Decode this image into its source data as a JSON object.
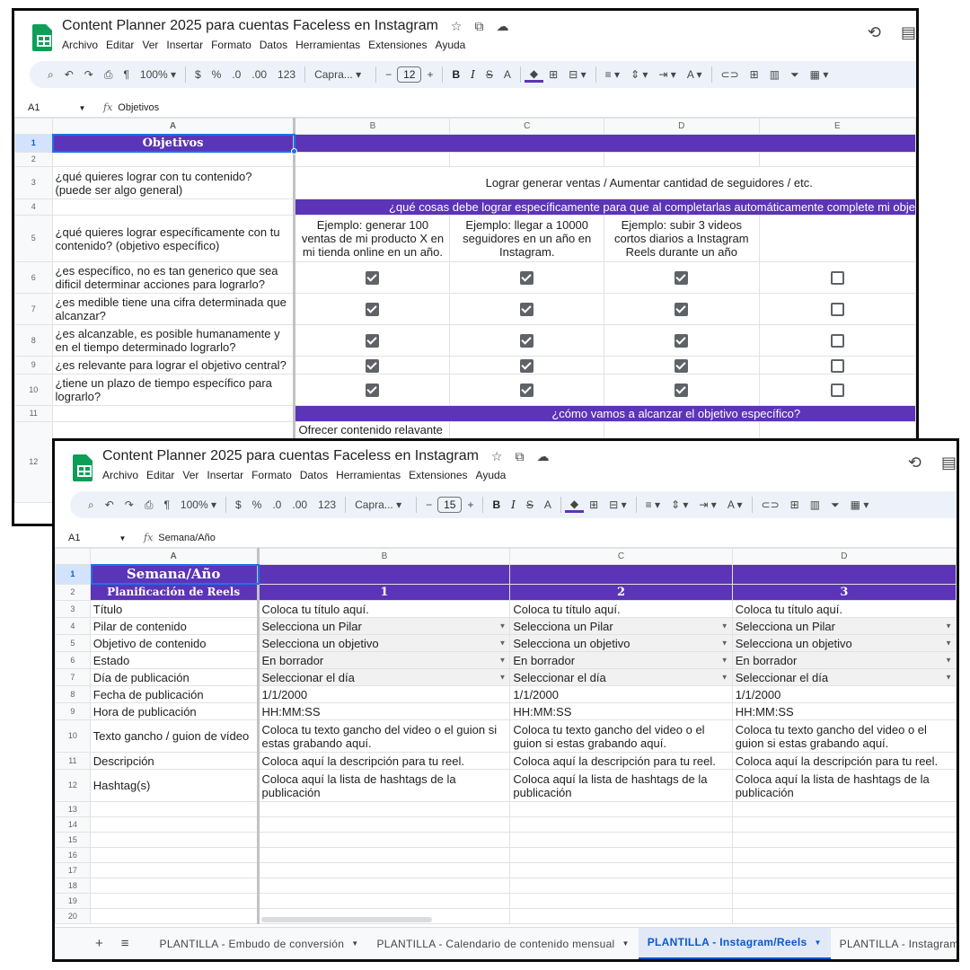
{
  "back_window": {
    "doc_title": "Content Planner 2025 para cuentas Faceless en Instagram",
    "menus": [
      "Archivo",
      "Editar",
      "Ver",
      "Insertar",
      "Formato",
      "Datos",
      "Herramientas",
      "Extensiones",
      "Ayuda"
    ],
    "toolbar": {
      "zoom": "100%",
      "currency": "$",
      "percent": "%",
      "dec_less": ".0",
      "dec_more": ".00",
      "number_format": "123",
      "font": "Capra...",
      "font_size": "12",
      "bold": "B",
      "italic": "I",
      "strike": "S",
      "text_color": "A"
    },
    "name_box": "A1",
    "formula": "Objetivos",
    "columns": [
      "A",
      "B",
      "C",
      "D",
      "E"
    ],
    "rows": [
      "1",
      "2",
      "3",
      "4",
      "5",
      "6",
      "7",
      "8",
      "9",
      "10",
      "11",
      "12"
    ],
    "title": "Objetivos",
    "goal_question": "¿qué quieres lograr con tu contenido? (puede ser algo general)",
    "goal_answer": "Lograr generar ventas / Aumentar cantidad de seguidores / etc.",
    "banner_row4": "¿qué cosas debe lograr específicamente para que al completarlas automáticamente complete mi obje",
    "specific_question": "¿qué quieres lograr específicamente con tu contenido? (objetivo específico)",
    "examples": [
      "Ejemplo: generar 100 ventas de mi producto X en mi tienda online en un año.",
      "Ejemplo: llegar a 10000 seguidores en un año en Instagram.",
      "Ejemplo: subir 3 videos cortos diarios a Instagram Reels durante un año"
    ],
    "criteria": [
      "¿es específico, no es tan generico que sea dificil determinar acciones para lograrlo?",
      "¿es medible tiene una cifra determinada que alcanzar?",
      "¿es alcanzable, es posible humanamente y en el tiempo determinado lograrlo?",
      "¿es relevante para lograr el objetivo central?",
      "¿tiene un plazo de tiempo específico para lograrlo?"
    ],
    "banner_row11": "¿cómo vamos a alcanzar el objetivo específico?",
    "row12_b": "Ofrecer contenido relavante"
  },
  "front_window": {
    "doc_title": "Content Planner 2025 para cuentas Faceless en Instagram",
    "menus": [
      "Archivo",
      "Editar",
      "Ver",
      "Insertar",
      "Formato",
      "Datos",
      "Herramientas",
      "Extensiones",
      "Ayuda"
    ],
    "toolbar": {
      "zoom": "100%",
      "currency": "$",
      "percent": "%",
      "dec_less": ".0",
      "dec_more": ".00",
      "number_format": "123",
      "font": "Capra...",
      "font_size": "15",
      "bold": "B",
      "italic": "I",
      "strike": "S",
      "text_color": "A"
    },
    "name_box": "A1",
    "formula": "Semana/Año",
    "columns": [
      "A",
      "B",
      "C",
      "D"
    ],
    "row_numbers": [
      "1",
      "2",
      "3",
      "4",
      "5",
      "6",
      "7",
      "8",
      "9",
      "10",
      "11",
      "12",
      "13",
      "14",
      "15",
      "16",
      "17",
      "18",
      "19",
      "20"
    ],
    "title": "Semana/Año",
    "subtitle": "Planificación de Reels",
    "week_numbers": [
      "1",
      "2",
      "3"
    ],
    "field_labels": [
      "Título",
      "Pilar de contenido",
      "Objetivo de contenido",
      "Estado",
      "Día de publicación",
      "Fecha de publicación",
      "Hora de publicación",
      "Texto gancho / guion de vídeo",
      "Descripción",
      "Hashtag(s)"
    ],
    "field_values": {
      "titulo": "Coloca tu título aquí.",
      "pilar": "Selecciona un Pilar",
      "objetivo": "Selecciona un objetivo",
      "estado": "En borrador",
      "dia": "Seleccionar el día",
      "fecha": "1/1/2000",
      "hora": "HH:MM:SS",
      "gancho": "Coloca tu texto gancho del video o el guion si estas grabando aquí.",
      "descripcion": "Coloca aquí la descripción para tu reel.",
      "hashtags": "Coloca aquí la lista de hashtags de la publicación"
    },
    "sheet_tabs": [
      "PLANTILLA - Embudo de conversión",
      "PLANTILLA - Calendario de contenido mensual",
      "PLANTILLA - Instagram/Reels",
      "PLANTILLA - Instagram/"
    ],
    "active_tab": "PLANTILLA - Instagram/Reels"
  },
  "icons": [
    "sheets-logo-icon",
    "star-icon",
    "move-to-folder-icon",
    "cloud-status-icon",
    "history-icon",
    "comments-icon",
    "search-icon",
    "undo-icon",
    "redo-icon",
    "print-icon",
    "paint-format-icon",
    "fill-color-icon",
    "borders-icon",
    "merge-icon",
    "align-icon",
    "valign-icon",
    "wrap-icon",
    "rotate-icon",
    "link-icon",
    "comment-icon",
    "chart-icon",
    "filter-icon",
    "add-sheet-icon",
    "all-sheets-icon"
  ],
  "colors": {
    "purple_header": "#5c34b8",
    "checkbox": "#5f6368",
    "active_tab": "#0b57d0",
    "selection": "#1a73e8",
    "sheets_green": "#0f9d58"
  }
}
